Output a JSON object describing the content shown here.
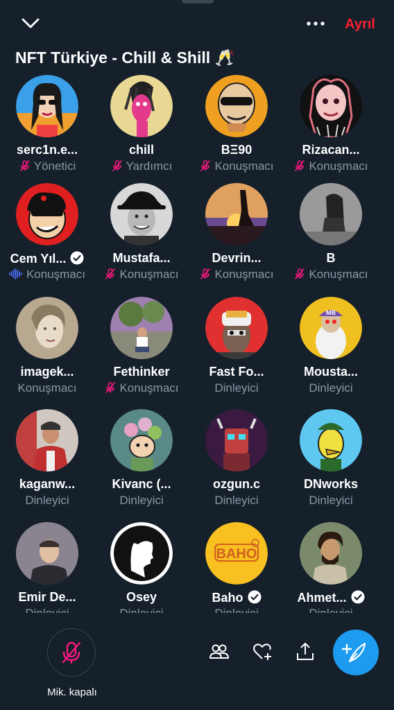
{
  "header": {
    "collapse_icon": "chevron-down-icon",
    "more_icon": "more-horizontal-icon",
    "leave_label": "Ayrıl",
    "title": "NFT Türkiye - Chill & Shill 🥂"
  },
  "participants": [
    {
      "name": "serc1n.e...",
      "role": "Yönetici",
      "mic": "muted",
      "verified": false
    },
    {
      "name": "chill",
      "role": "Yardımcı",
      "mic": "muted",
      "verified": false
    },
    {
      "name": "BΞ90",
      "role": "Konuşmacı",
      "mic": "muted",
      "verified": false
    },
    {
      "name": "Rizacan...",
      "role": "Konuşmacı",
      "mic": "muted",
      "verified": false
    },
    {
      "name": "Cem Yıl...",
      "role": "Konuşmacı",
      "mic": "speaking",
      "verified": true
    },
    {
      "name": "Mustafa...",
      "role": "Konuşmacı",
      "mic": "muted",
      "verified": false
    },
    {
      "name": "Devrin...",
      "role": "Konuşmacı",
      "mic": "muted",
      "verified": false
    },
    {
      "name": "B",
      "role": "Konuşmacı",
      "mic": "muted",
      "verified": false
    },
    {
      "name": "imagek...",
      "role": "Konuşmacı",
      "mic": "none",
      "verified": false
    },
    {
      "name": "Fethinker",
      "role": "Konuşmacı",
      "mic": "muted",
      "verified": false
    },
    {
      "name": "Fast Fo...",
      "role": "Dinleyici",
      "mic": "none",
      "verified": false
    },
    {
      "name": "Mousta...",
      "role": "Dinleyici",
      "mic": "none",
      "verified": false
    },
    {
      "name": "kaganw...",
      "role": "Dinleyici",
      "mic": "none",
      "verified": false
    },
    {
      "name": "Kivanc (...",
      "role": "Dinleyici",
      "mic": "none",
      "verified": false
    },
    {
      "name": "ozgun.c",
      "role": "Dinleyici",
      "mic": "none",
      "verified": false
    },
    {
      "name": "DNworks",
      "role": "Dinleyici",
      "mic": "none",
      "verified": false
    },
    {
      "name": "Emir De...",
      "role": "Dinleyici",
      "mic": "none",
      "verified": false
    },
    {
      "name": "Osey",
      "role": "Dinleyici",
      "mic": "none",
      "verified": false
    },
    {
      "name": "Baho",
      "role": "Dinleyici",
      "mic": "none",
      "verified": true
    },
    {
      "name": "Ahmet...",
      "role": "Dinleyici",
      "mic": "none",
      "verified": true
    }
  ],
  "avatar_text": {
    "baho": "BAHO",
    "mb": "MB"
  },
  "bottom": {
    "mic_label": "Mik. kapalı",
    "mic_icon": "mic-off-icon",
    "people_icon": "people-icon",
    "react_icon": "heart-plus-icon",
    "share_icon": "share-icon",
    "compose_icon": "compose-icon"
  },
  "colors": {
    "background": "#15202b",
    "accent": "#1d9bf0",
    "leave": "#f4212e",
    "muted_mic": "#f91880",
    "speaking": "#4c6ef5",
    "secondary_text": "#8b98a5"
  }
}
